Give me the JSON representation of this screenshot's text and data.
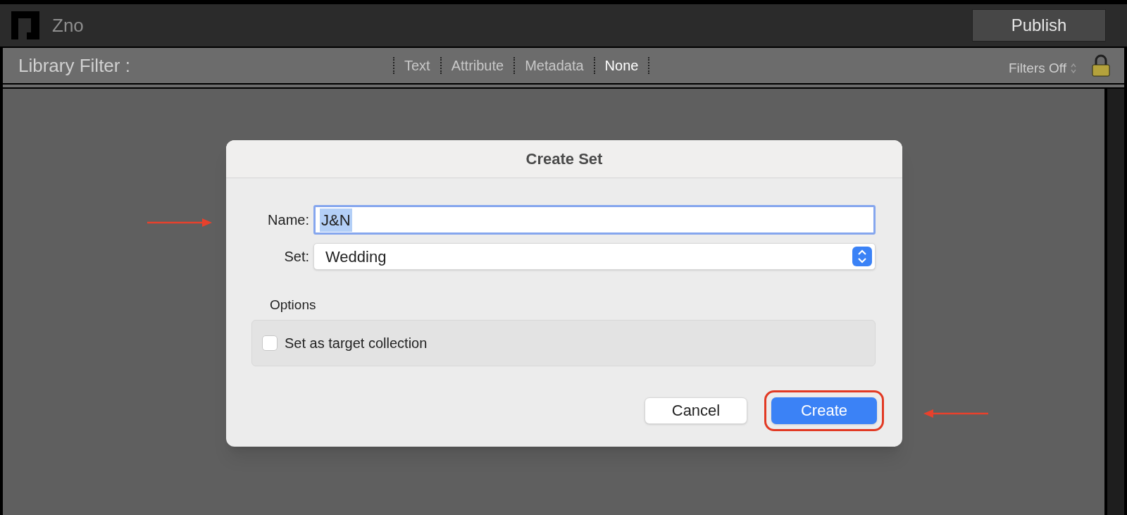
{
  "app_bar": {
    "title": "Zno",
    "publish_button": "Publish"
  },
  "filter_bar": {
    "label": "Library Filter :",
    "tabs": [
      {
        "label": "Text",
        "selected": false
      },
      {
        "label": "Attribute",
        "selected": false
      },
      {
        "label": "Metadata",
        "selected": false
      },
      {
        "label": "None",
        "selected": true
      }
    ],
    "filters_dropdown": "Filters Off",
    "locked": true
  },
  "dialog": {
    "title": "Create Set",
    "name_label": "Name:",
    "name_value": "J&N",
    "set_label": "Set:",
    "set_value": "Wedding",
    "options_label": "Options",
    "options": [
      {
        "label": "Set as target collection",
        "checked": false
      }
    ],
    "buttons": [
      {
        "label": "Cancel",
        "kind": "secondary",
        "highlighted": false
      },
      {
        "label": "Create",
        "kind": "primary",
        "highlighted": true
      }
    ]
  },
  "annotations": [
    {
      "kind": "right-arrow"
    },
    {
      "kind": "left-arrow"
    }
  ]
}
